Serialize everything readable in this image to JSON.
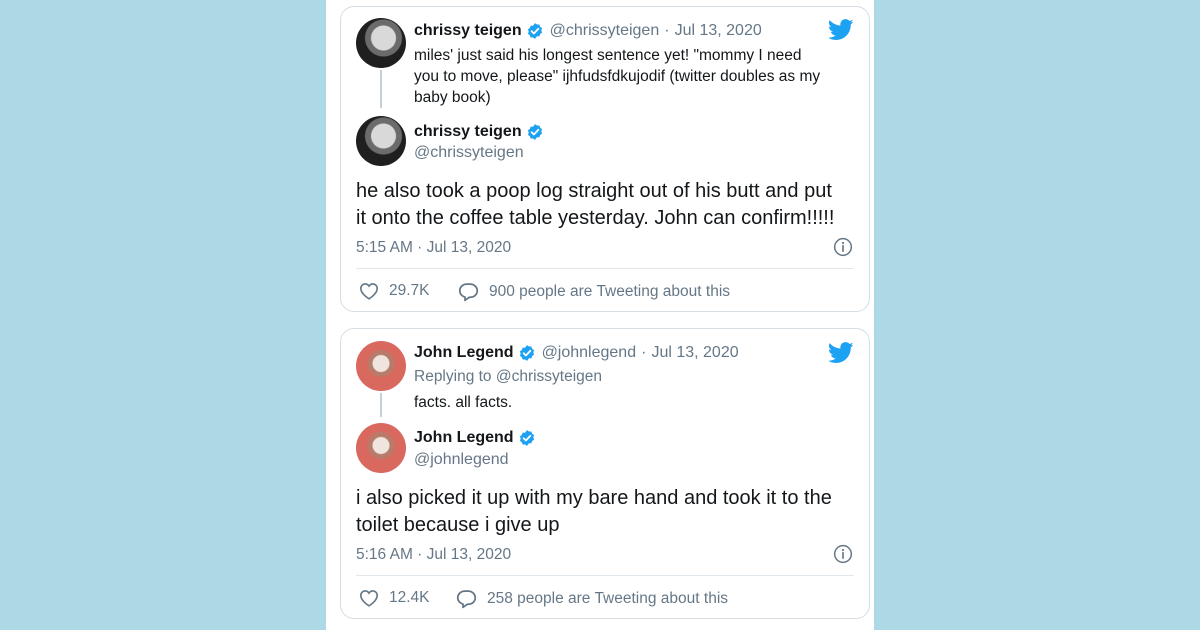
{
  "tweets": [
    {
      "parent": {
        "name": "chrissy teigen",
        "handle": "@chrissyteigen",
        "date": "Jul 13, 2020",
        "text_lines": [
          "miles' just said his longest sentence yet! \"mommy I need",
          "you to move, please\" ijhfudsfdkujodif (twitter doubles as my",
          "baby book)"
        ]
      },
      "reply": {
        "name": "chrissy teigen",
        "handle": "@chrissyteigen",
        "text_lines": [
          "he also took a poop log straight out of his butt and put",
          "it onto the coffee table yesterday. John can confirm!!!!!"
        ],
        "timestamp": "5:15 AM · Jul 13, 2020",
        "likes": "29.7K",
        "talking": "900 people are Tweeting about this"
      }
    },
    {
      "parent": {
        "name": "John Legend",
        "handle": "@johnlegend",
        "date": "Jul 13, 2020",
        "replying_to": "Replying to @chrissyteigen",
        "text_lines": [
          "facts.  all facts."
        ]
      },
      "reply": {
        "name": "John Legend",
        "handle": "@johnlegend",
        "text_lines": [
          "i also picked it up with my bare hand and took it to the",
          "toilet because i give up"
        ],
        "timestamp": "5:16 AM · Jul 13, 2020",
        "likes": "12.4K",
        "talking": "258 people are Tweeting about this"
      }
    }
  ],
  "ui": {
    "separator": "·",
    "icons": {
      "brand": "twitter-bird-icon",
      "verified": "verified-badge-icon",
      "like": "heart-icon",
      "reply": "speech-bubble-icon",
      "info": "info-icon"
    },
    "colors": {
      "background": "#add8e6",
      "twitter_blue": "#1da1f2",
      "secondary_text": "#657786"
    }
  }
}
